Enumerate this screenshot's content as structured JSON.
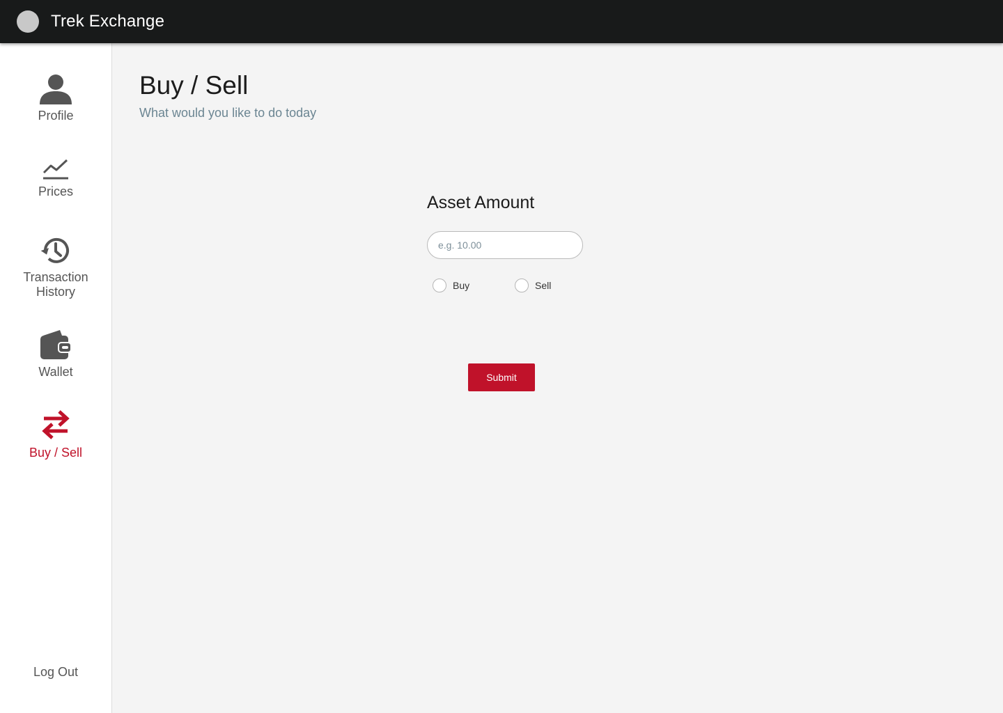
{
  "app": {
    "title": "Trek Exchange",
    "accent_color": "#c0122a"
  },
  "sidebar": {
    "items": [
      {
        "label": "Profile",
        "icon": "user-icon"
      },
      {
        "label": "Prices",
        "icon": "chart-line-icon"
      },
      {
        "label": "Transaction History",
        "icon": "history-icon"
      },
      {
        "label": "Wallet",
        "icon": "wallet-icon"
      },
      {
        "label": "Buy / Sell",
        "icon": "exchange-icon",
        "active": true
      }
    ],
    "logout_label": "Log Out"
  },
  "main": {
    "title": "Buy / Sell",
    "subtitle": "What would you like to do today",
    "form": {
      "amount_label": "Asset Amount",
      "amount_placeholder": "e.g. 10.00",
      "amount_value": "",
      "options": [
        {
          "label": "Buy",
          "selected": false
        },
        {
          "label": "Sell",
          "selected": false
        }
      ],
      "submit_label": "Submit"
    }
  }
}
